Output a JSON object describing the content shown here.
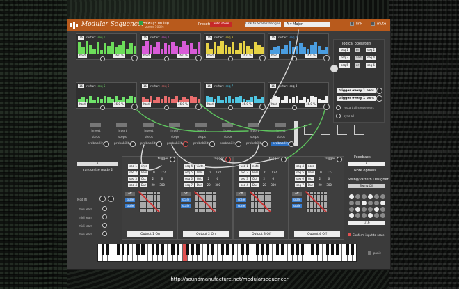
{
  "app": {
    "title": "Modular Sequencer",
    "always_on_top": "always on top",
    "zoom": "zoom 100%",
    "presets_label": "Presets",
    "preset_button": "auto store",
    "scale_button": "Link to Scale Changes",
    "key": "A",
    "scale": "Major",
    "toggle_a": "link",
    "toggle_b": "mute"
  },
  "sequences": [
    {
      "name": "seq 1",
      "length": "16",
      "mode": "restart",
      "rate": "16.0 %",
      "hold": "hold",
      "color": "#6cdd5a"
    },
    {
      "name": "seq 2",
      "length": "16",
      "mode": "restart",
      "rate": "16.0 %",
      "hold": "hold",
      "color": "#d85bd8"
    },
    {
      "name": "seq 3",
      "length": "16",
      "mode": "restart",
      "rate": "16.0 %",
      "hold": "hold",
      "color": "#e6d245"
    },
    {
      "name": "seq 4",
      "length": "16",
      "mode": "restart",
      "rate": "16.0 %",
      "hold": "hold",
      "color": "#4a9de0"
    },
    {
      "name": "seq 5",
      "length": "16",
      "mode": "restart",
      "rate": "16.0 %",
      "hold": "hold",
      "color": "#6fe26b"
    },
    {
      "name": "seq 6",
      "length": "16",
      "mode": "restart",
      "rate": "16.0 %",
      "hold": "hold",
      "color": "#ea6d6d"
    },
    {
      "name": "seq 7",
      "length": "16",
      "mode": "restart",
      "rate": "16.0 %",
      "hold": "hold",
      "color": "#4ec4e0"
    },
    {
      "name": "seq 8",
      "length": "16",
      "mode": "restart",
      "rate": "16.0 %",
      "hold": "hold",
      "color": "#f0f0f0"
    }
  ],
  "logic": {
    "title": "logical operators",
    "ops": [
      {
        "a": "seq 1",
        "op": "or",
        "b": "seq 2"
      },
      {
        "a": "seq 3",
        "op": "and",
        "b": "seq 4"
      },
      {
        "a": "seq 5",
        "op": "or",
        "b": "seq 6"
      }
    ],
    "trigger_every_1": "trigger every 1 bars",
    "trigger_every_2": "trigger every 1 bars",
    "restart_all": "restart all sequencers",
    "sync_all": "sync all"
  },
  "prob_row": {
    "labels": [
      "invert",
      "steps",
      "probability"
    ],
    "cols": 8,
    "highlight": "probability"
  },
  "random_panel": {
    "mode_button": "A",
    "mode_label": "randomize mode 2",
    "mod_in": "Mod IN",
    "midi_learn": [
      "midi learn",
      "midi learn",
      "midi learn",
      "midi learn"
    ]
  },
  "outputs": [
    {
      "label": "Output 1 On",
      "trigger": "trigger",
      "rows": [
        {
          "seq": "seq 1",
          "p": "note"
        },
        {
          "seq": "seq 2",
          "p": "Velo",
          "v1": "0",
          "v2": "127"
        },
        {
          "seq": "seq 3",
          "p": "Oct",
          "v1": "2",
          "v2": "6"
        },
        {
          "seq": "seq 4",
          "p": "Dur",
          "v1": "20",
          "v2": "300"
        }
      ],
      "btns": [
        "off",
        "scale",
        "scale"
      ]
    },
    {
      "label": "Output 2 On",
      "trigger": "trigger",
      "rows": [
        {
          "seq": "seq 4",
          "p": "Gate"
        },
        {
          "seq": "seq 5",
          "p": "Velo",
          "v1": "0",
          "v2": "127"
        },
        {
          "seq": "seq 6",
          "p": "Oct",
          "v1": "2",
          "v2": "6"
        },
        {
          "seq": "seq 7",
          "p": "Dur",
          "v1": "20",
          "v2": "300"
        }
      ],
      "btns": [
        "off",
        "scale",
        "scale"
      ]
    },
    {
      "label": "Output 3 Off",
      "trigger": "trigger",
      "rows": [
        {
          "seq": "seq 1",
          "p": "note"
        },
        {
          "seq": "seq 2",
          "p": "Velo",
          "v1": "0",
          "v2": "127"
        },
        {
          "seq": "seq 3",
          "p": "Oct",
          "v1": "2",
          "v2": "6"
        },
        {
          "seq": "seq 4",
          "p": "Dur",
          "v1": "20",
          "v2": "300"
        }
      ],
      "btns": [
        "off",
        "scale",
        "scale"
      ]
    },
    {
      "label": "Output 4 Off",
      "trigger": "trigger",
      "rows": [
        {
          "seq": "seq 4",
          "p": "note"
        },
        {
          "seq": "seq 5",
          "p": "Velo",
          "v1": "0",
          "v2": "127"
        },
        {
          "seq": "seq 6",
          "p": "Oct",
          "v1": "2",
          "v2": "6"
        },
        {
          "seq": "seq 7",
          "p": "Dur",
          "v1": "20",
          "v2": "300"
        }
      ],
      "btns": [
        "off",
        "scale",
        "scale"
      ]
    }
  ],
  "swing": {
    "feedback": "Feedback",
    "a_button": "A",
    "note_options": "Note options",
    "designer": "Swing/Pattern Designer",
    "swing_off": "Swing Off",
    "ratio": "1/16",
    "conform": "Conform input to scale",
    "panic": "panic"
  },
  "caption": "http://soundmanufacture.net/modularsequencer"
}
